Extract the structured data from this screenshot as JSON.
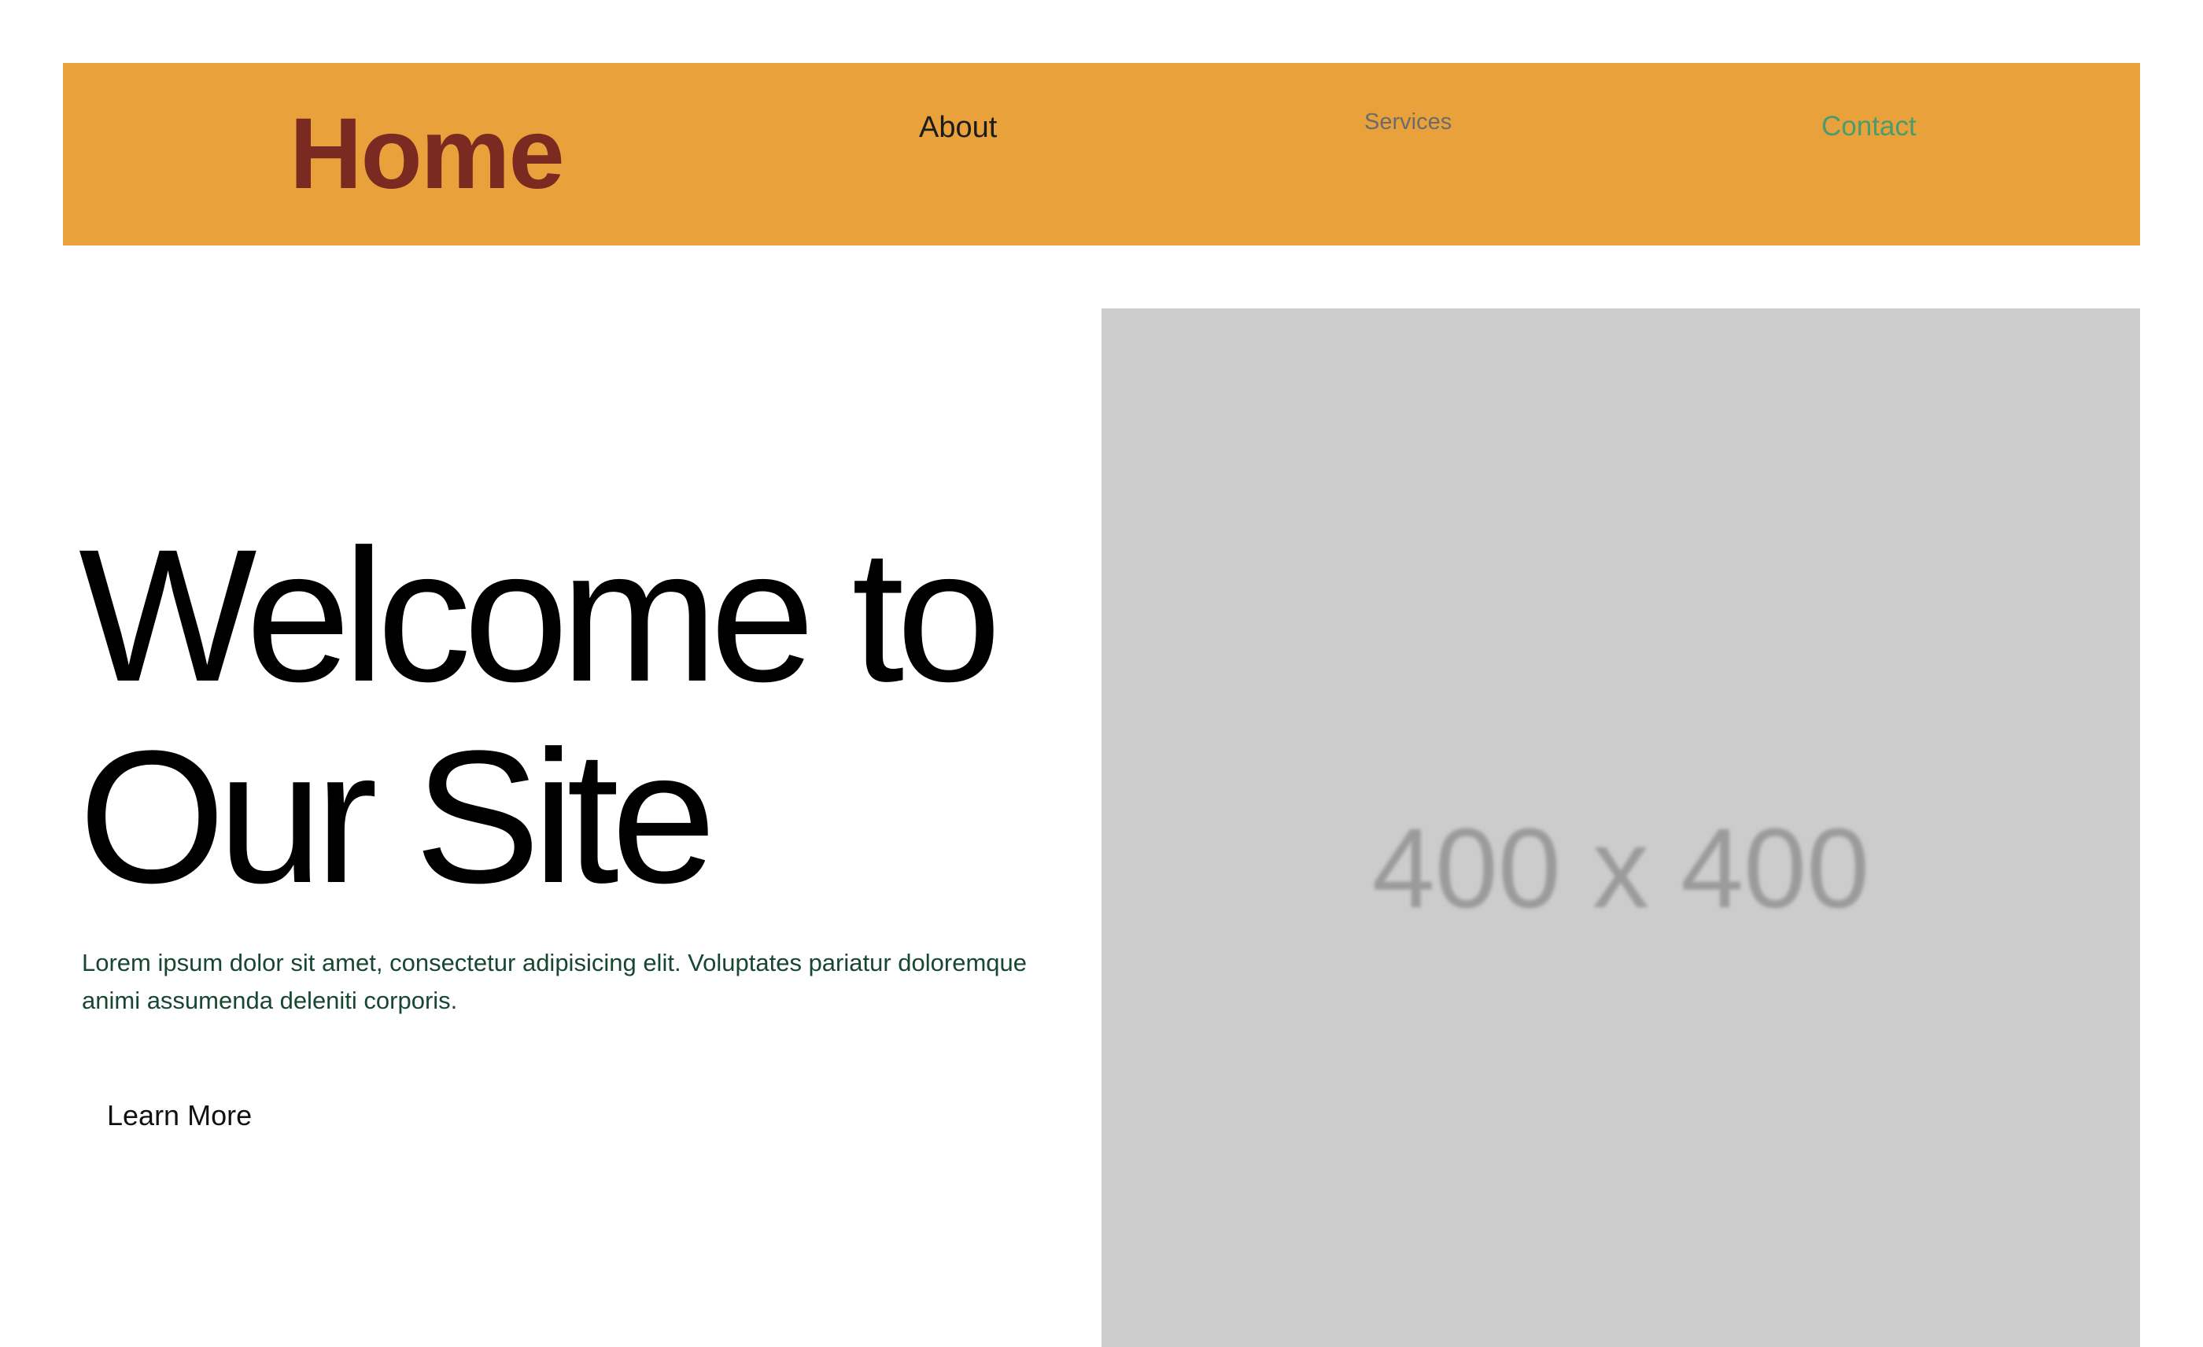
{
  "nav": {
    "home_label": "Home",
    "about_label": "About",
    "services_label": "Services",
    "contact_label": "Contact"
  },
  "hero": {
    "title_line1": "Welcome to",
    "title_line2": "Our Site",
    "description": "Lorem ipsum dolor sit amet, consectetur adipisicing elit. Voluptates pariatur doloremque animi assumenda deleniti corporis.",
    "button_label": "Learn More",
    "image_placeholder_text": "400 x 400"
  },
  "colors": {
    "nav_background": "#e9a23b",
    "home_text": "#7b2a22",
    "contact_text": "#4a9b6e",
    "description_text": "#174732",
    "placeholder_background": "#cccccc"
  }
}
